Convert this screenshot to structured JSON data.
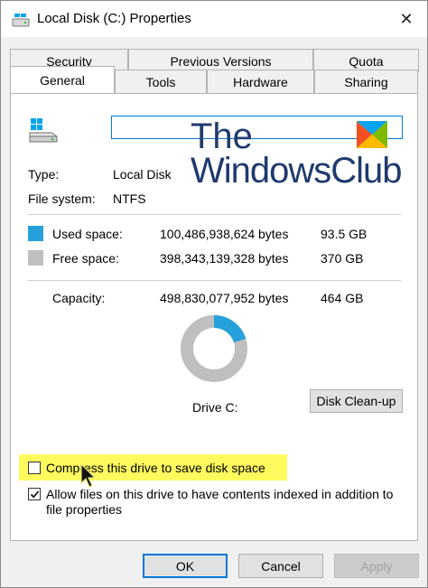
{
  "window": {
    "title": "Local Disk (C:) Properties",
    "close_glyph": "✕"
  },
  "tabs": {
    "row1": [
      "Security",
      "Previous Versions",
      "Quota"
    ],
    "row2": [
      "General",
      "Tools",
      "Hardware",
      "Sharing"
    ],
    "active": "General"
  },
  "general": {
    "drive_name_value": "",
    "type_label": "Type:",
    "type_value": "Local Disk",
    "fs_label": "File system:",
    "fs_value": "NTFS",
    "used_label": "Used space:",
    "used_bytes": "100,486,938,624 bytes",
    "used_gb": "93.5 GB",
    "free_label": "Free space:",
    "free_bytes": "398,343,139,328 bytes",
    "free_gb": "370 GB",
    "capacity_label": "Capacity:",
    "capacity_bytes": "498,830,077,952 bytes",
    "capacity_gb": "464 GB",
    "drive_label": "Drive C:",
    "used_fraction": 0.2014,
    "cleanup_label": "Disk Clean-up",
    "compress_label": "Compress this drive to save disk space",
    "compress_checked": false,
    "index_label_line1": "Allow files on this drive to have contents indexed in addition to",
    "index_label_line2": "file properties",
    "index_checked": true
  },
  "watermark": {
    "line1": "The",
    "line2": "WindowsClub"
  },
  "buttons": {
    "ok": "OK",
    "cancel": "Cancel",
    "apply": "Apply"
  },
  "colors": {
    "used": "#26a0da",
    "free": "#bfbfbf",
    "accent": "#0078d7",
    "highlight": "#fffb5e"
  },
  "icons": [
    "drive-icon",
    "close-icon",
    "checkmark-icon",
    "mouse-pointer-icon",
    "windows-logo-icon"
  ]
}
